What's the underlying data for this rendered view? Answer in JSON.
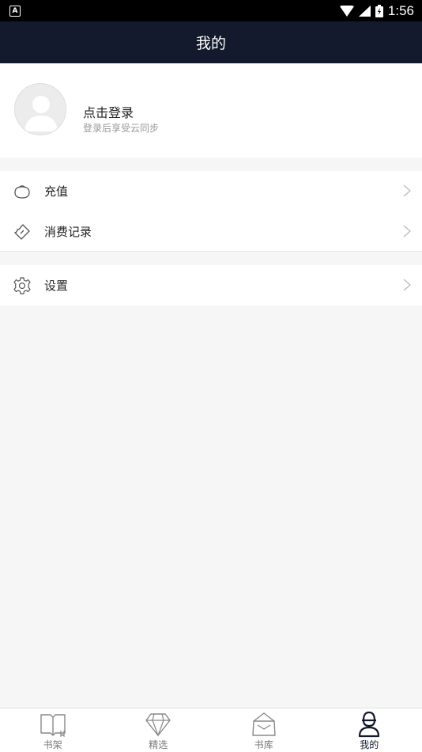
{
  "status_bar": {
    "time": "1:56",
    "app_badge": "A"
  },
  "header": {
    "title": "我的"
  },
  "profile": {
    "name": "点击登录",
    "subtitle": "登录后享受云同步"
  },
  "menu_group_1": [
    {
      "label": "充值",
      "icon": "coin-purse-icon"
    },
    {
      "label": "消费记录",
      "icon": "ticket-icon"
    }
  ],
  "menu_group_2": [
    {
      "label": "设置",
      "icon": "gear-icon"
    }
  ],
  "tabs": [
    {
      "label": "书架",
      "icon": "open-book-icon",
      "active": false
    },
    {
      "label": "精选",
      "icon": "diamond-icon",
      "active": false
    },
    {
      "label": "书库",
      "icon": "bag-icon",
      "active": false
    },
    {
      "label": "我的",
      "icon": "person-icon",
      "active": true
    }
  ],
  "colors": {
    "header_bg": "#141a2d",
    "status_bg": "#000000",
    "page_bg": "#f6f6f6",
    "active_tab": "#141a2d"
  }
}
